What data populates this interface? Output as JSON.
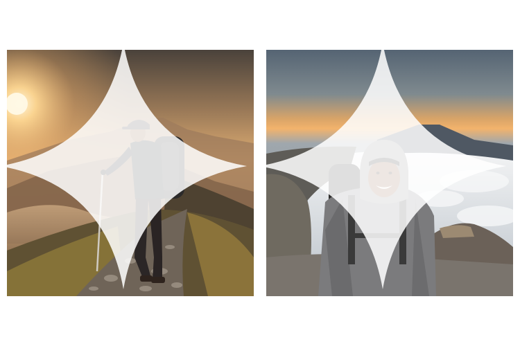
{
  "images": [
    {
      "name": "left",
      "description_hidden": false,
      "icon": "sparkle-icon"
    },
    {
      "name": "right",
      "icon": "sparkle-icon"
    }
  ],
  "colors": {
    "left_sky_top": "#3f3a36",
    "left_sky_mid": "#b58a5f",
    "left_sky_glow": "#f4c27a",
    "right_sky_top": "#5a6876",
    "right_sky_horizon": "#f1b46c",
    "clouds": "#dfe3e7"
  }
}
